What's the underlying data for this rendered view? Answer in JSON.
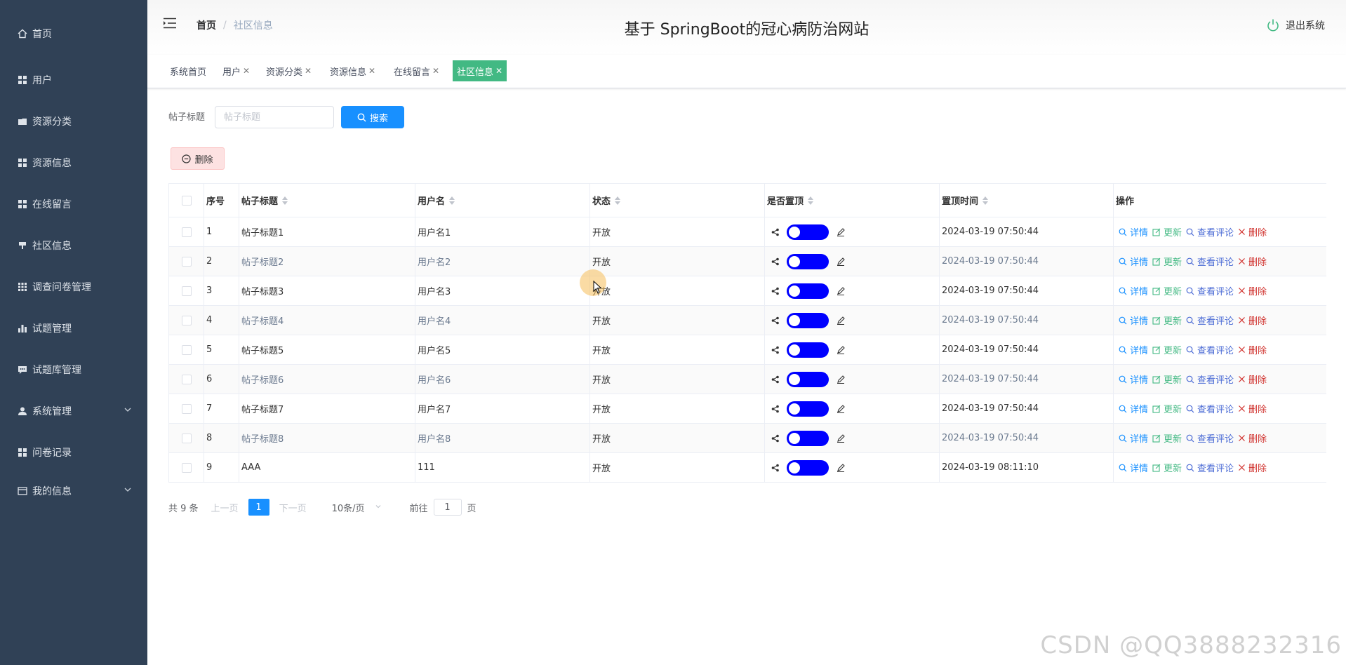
{
  "sidebar": {
    "items": [
      {
        "label": "首页",
        "icon": "home-icon"
      },
      {
        "label": "用户",
        "icon": "grid-icon"
      },
      {
        "label": "资源分类",
        "icon": "folder-icon"
      },
      {
        "label": "资源信息",
        "icon": "grid-icon"
      },
      {
        "label": "在线留言",
        "icon": "grid-icon"
      },
      {
        "label": "社区信息",
        "icon": "cup-icon"
      },
      {
        "label": "调查问卷管理",
        "icon": "apps-icon"
      },
      {
        "label": "试题管理",
        "icon": "bar-chart-icon"
      },
      {
        "label": "试题库管理",
        "icon": "chat-icon"
      },
      {
        "label": "系统管理",
        "icon": "user-icon"
      },
      {
        "label": "问卷记录",
        "icon": "grid-icon"
      },
      {
        "label": "我的信息",
        "icon": "card-icon"
      }
    ]
  },
  "header": {
    "breadcrumb_home": "首页",
    "breadcrumb_current": "社区信息",
    "site_title": "基于 SpringBoot的冠心病防治网站",
    "logout_label": "退出系统"
  },
  "tags": [
    "系统首页",
    "用户",
    "资源分类",
    "资源信息",
    "在线留言",
    "社区信息"
  ],
  "tags_active": "社区信息",
  "search": {
    "label": "帖子标题",
    "placeholder": "帖子标题",
    "button_label": "搜索"
  },
  "delete_button_label": "删除",
  "table": {
    "columns": [
      "序号",
      "帖子标题",
      "用户名",
      "状态",
      "是否置顶",
      "置顶时间",
      "操作"
    ],
    "rows": [
      {
        "idx": "1",
        "title": "帖子标题1",
        "user": "用户名1",
        "status": "开放",
        "top_time": "2024-03-19 07:50:44"
      },
      {
        "idx": "2",
        "title": "帖子标题2",
        "user": "用户名2",
        "status": "开放",
        "top_time": "2024-03-19 07:50:44"
      },
      {
        "idx": "3",
        "title": "帖子标题3",
        "user": "用户名3",
        "status": "开放",
        "top_time": "2024-03-19 07:50:44"
      },
      {
        "idx": "4",
        "title": "帖子标题4",
        "user": "用户名4",
        "status": "开放",
        "top_time": "2024-03-19 07:50:44"
      },
      {
        "idx": "5",
        "title": "帖子标题5",
        "user": "用户名5",
        "status": "开放",
        "top_time": "2024-03-19 07:50:44"
      },
      {
        "idx": "6",
        "title": "帖子标题6",
        "user": "用户名6",
        "status": "开放",
        "top_time": "2024-03-19 07:50:44"
      },
      {
        "idx": "7",
        "title": "帖子标题7",
        "user": "用户名7",
        "status": "开放",
        "top_time": "2024-03-19 07:50:44"
      },
      {
        "idx": "8",
        "title": "帖子标题8",
        "user": "用户名8",
        "status": "开放",
        "top_time": "2024-03-19 07:50:44"
      },
      {
        "idx": "9",
        "title": "AAA",
        "user": "111",
        "status": "开放",
        "top_time": "2024-03-19 08:11:10"
      }
    ],
    "ops": {
      "detail": "详情",
      "update": "更新",
      "comments": "查看评论",
      "delete": "删除"
    }
  },
  "pagination": {
    "total": "共 9 条",
    "prev": "上一页",
    "current_page": "1",
    "next": "下一页",
    "page_size": "10条/页",
    "goto_label": "前往",
    "goto_value": "1",
    "page_suffix": "页"
  },
  "watermark": "CSDN @QQ3888232316",
  "colors": {
    "sidebar_bg": "#304156",
    "primary": "#1890ff",
    "active_tag": "#42b983",
    "switch_on": "#0000ff",
    "danger": "#d0312d"
  }
}
